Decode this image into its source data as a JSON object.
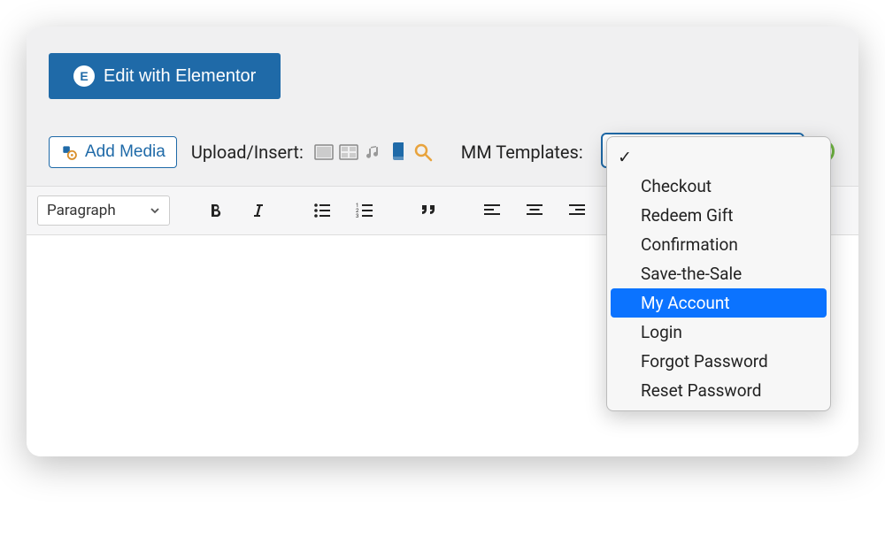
{
  "elementor": {
    "button_label": "Edit with Elementor"
  },
  "media": {
    "add_media_label": "Add Media",
    "upload_insert_label": "Upload/Insert:"
  },
  "mm": {
    "label": "MM Templates:",
    "options": [
      {
        "label": "",
        "blank": true
      },
      {
        "label": "Checkout"
      },
      {
        "label": "Redeem Gift"
      },
      {
        "label": "Confirmation"
      },
      {
        "label": "Save-the-Sale"
      },
      {
        "label": "My Account",
        "selected": true
      },
      {
        "label": "Login"
      },
      {
        "label": "Forgot Password"
      },
      {
        "label": "Reset Password"
      }
    ]
  },
  "editor": {
    "format_label": "Paragraph"
  }
}
